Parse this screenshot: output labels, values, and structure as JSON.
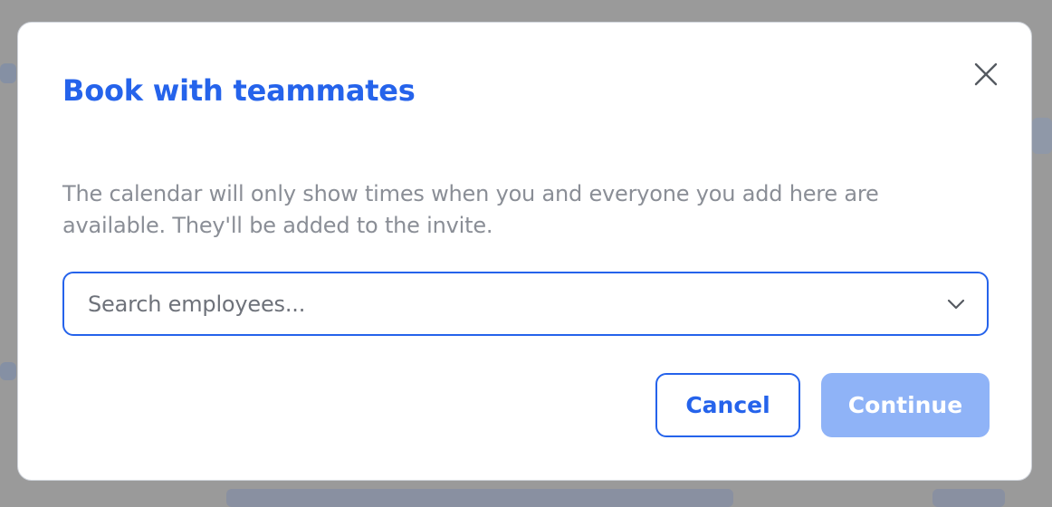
{
  "modal": {
    "title": "Book with teammates",
    "description": "The calendar will only show times when you and everyone you add here are available. They'll be added to the invite.",
    "search": {
      "placeholder": "Search employees...",
      "value": ""
    },
    "buttons": {
      "cancel_label": "Cancel",
      "continue_label": "Continue"
    }
  },
  "icons": {
    "close": "close-icon",
    "dropdown": "chevron-down-icon"
  },
  "colors": {
    "accent": "#2563eb",
    "accent_disabled": "#8fb3f7",
    "muted_text": "#8a8e96",
    "backdrop": "#9a9a9a"
  }
}
